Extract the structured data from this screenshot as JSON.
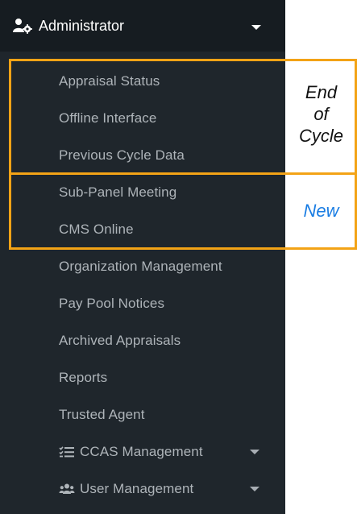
{
  "header": {
    "title": "Administrator",
    "icon": "user-cog-icon"
  },
  "menu": {
    "items": [
      {
        "label": "Appraisal Status"
      },
      {
        "label": "Offline Interface"
      },
      {
        "label": "Previous Cycle Data"
      },
      {
        "label": "Sub-Panel Meeting"
      },
      {
        "label": "CMS Online"
      },
      {
        "label": "Organization Management"
      },
      {
        "label": "Pay Pool Notices"
      },
      {
        "label": "Archived Appraisals"
      },
      {
        "label": "Reports"
      },
      {
        "label": "Trusted Agent"
      },
      {
        "label": "CCAS Management",
        "icon": "checklist-icon"
      },
      {
        "label": "User Management",
        "icon": "users-icon"
      }
    ]
  },
  "annotations": {
    "end_of_cycle": [
      "End",
      "of",
      "Cycle"
    ],
    "new": "New"
  },
  "colors": {
    "sidebar_bg": "#1f262c",
    "header_bg": "#161c21",
    "menu_text": "#aeb4b9",
    "highlight_border": "#f3a316",
    "new_text": "#1a7de3"
  }
}
